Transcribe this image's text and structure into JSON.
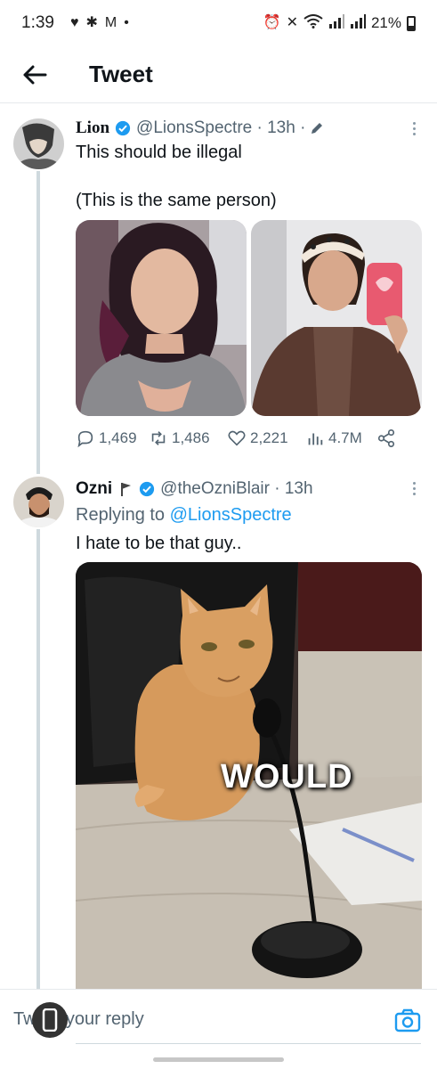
{
  "status_bar": {
    "time": "1:39",
    "battery": "21%"
  },
  "header": {
    "title": "Tweet"
  },
  "tweet1": {
    "name": "Lion",
    "handle": "@LionsSpectre · 13h ·",
    "text_line1": "This should be illegal",
    "text_line2": "(This is the same person)",
    "replies": "1,469",
    "retweets": "1,486",
    "likes": "2,221",
    "views": "4.7M"
  },
  "tweet2": {
    "name": "Ozni",
    "handle": "@theOzniBlair · 13h",
    "replying_prefix": "Replying to ",
    "replying_to": "@LionsSpectre",
    "text": "I hate to be that guy..",
    "meme_caption": "WOULD"
  },
  "reply_bar": {
    "placeholder": "Tweet your reply"
  },
  "colors": {
    "accent": "#1d9bf0",
    "secondary_text": "#536471"
  }
}
